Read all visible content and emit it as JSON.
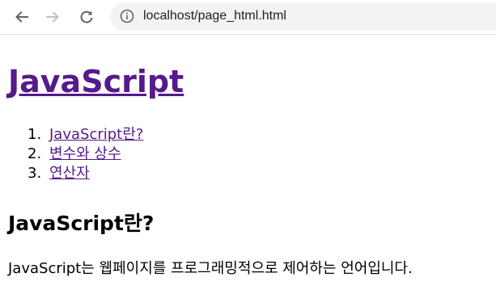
{
  "browser": {
    "url": "localhost/page_html.html",
    "icons": {
      "back": "arrow-left-icon",
      "forward": "arrow-right-icon",
      "reload": "reload-icon",
      "site_info": "info-icon"
    }
  },
  "page": {
    "title": "JavaScript",
    "toc": [
      {
        "number": "1.",
        "label": "JavaScript란?"
      },
      {
        "number": "2.",
        "label": "변수와 상수"
      },
      {
        "number": "3.",
        "label": "연산자"
      }
    ],
    "section_heading": "JavaScript란?",
    "body_text": "JavaScript는 웹페이지를 프로그래밍적으로 제어하는 언어입니다."
  },
  "colors": {
    "visited_link": "#551a8b",
    "omnibox_bg": "#f1f3f4",
    "icon_active": "#5f6368",
    "icon_disabled": "#bdc1c6"
  }
}
